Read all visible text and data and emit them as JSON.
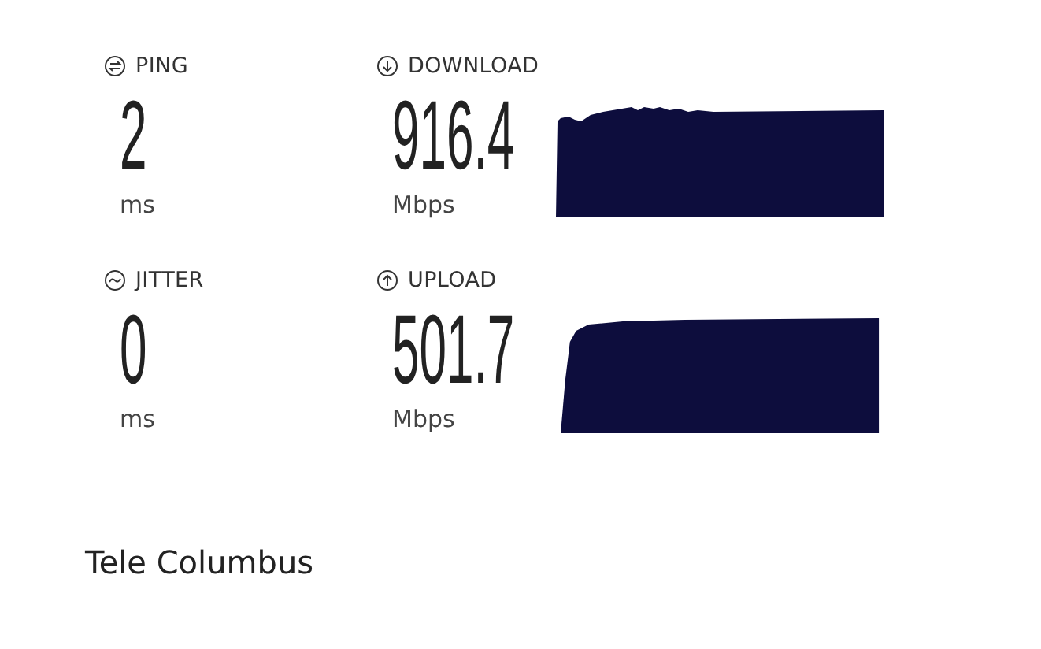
{
  "metrics": [
    {
      "kind": "ping",
      "label": "PING",
      "value": "2",
      "unit": "ms"
    },
    {
      "kind": "download",
      "label": "DOWNLOAD",
      "value": "916.4",
      "unit": "Mbps"
    },
    {
      "kind": "jitter",
      "label": "JITTER",
      "value": "0",
      "unit": "ms"
    },
    {
      "kind": "upload",
      "label": "UPLOAD",
      "value": "501.7",
      "unit": "Mbps"
    }
  ],
  "provider": "Tele Columbus"
}
